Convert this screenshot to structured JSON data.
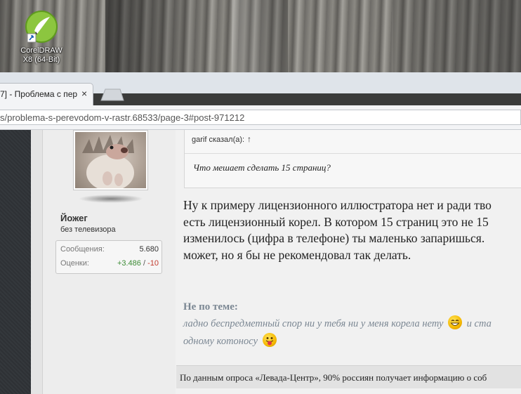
{
  "desktop": {
    "icon_label_line1": "CorelDRAW",
    "icon_label_line2": "X8 (64-Bit)"
  },
  "browser": {
    "tab_title": "7] - Проблема с пер",
    "close_symbol": "×",
    "address": "s/problema-s-perevodom-v-rastr.68533/page-3#post-971212"
  },
  "user": {
    "name": "Йожег",
    "title": "без телевизора",
    "stats": {
      "messages_label": "Сообщения:",
      "messages_value": "5.680",
      "ratings_label": "Оценки:",
      "ratings_positive": "+3.486",
      "ratings_separator": "/",
      "ratings_negative": "-10"
    }
  },
  "quote": {
    "author": "garif сказал(а):",
    "up_arrow": "↑",
    "text": "Что мешает сделать 15 страниц?"
  },
  "message": {
    "lines": [
      "Ну к примеру лицензионного иллюстратора нет и ради тво",
      "есть лицензионный корел. В котором 15 страниц это не 15",
      "изменилось (цифра в телефоне) ты маленько запаришься.",
      "может, но я бы не рекомендовал так делать."
    ]
  },
  "offtopic": {
    "title": "Не по теме:",
    "line1_a": "ладно беспредметный спор ни у тебя ни у меня корела нету",
    "line1_b": "и ста",
    "line2": "одному котоносу"
  },
  "signature": {
    "text": "По данным опроса «Левада-Центр», 90% россиян получает информацию о соб"
  },
  "colors": {
    "offtopic": "#7b8793",
    "positive": "#3c8b35",
    "negative": "#c23b2e",
    "corel_green": "#8cc63f"
  }
}
